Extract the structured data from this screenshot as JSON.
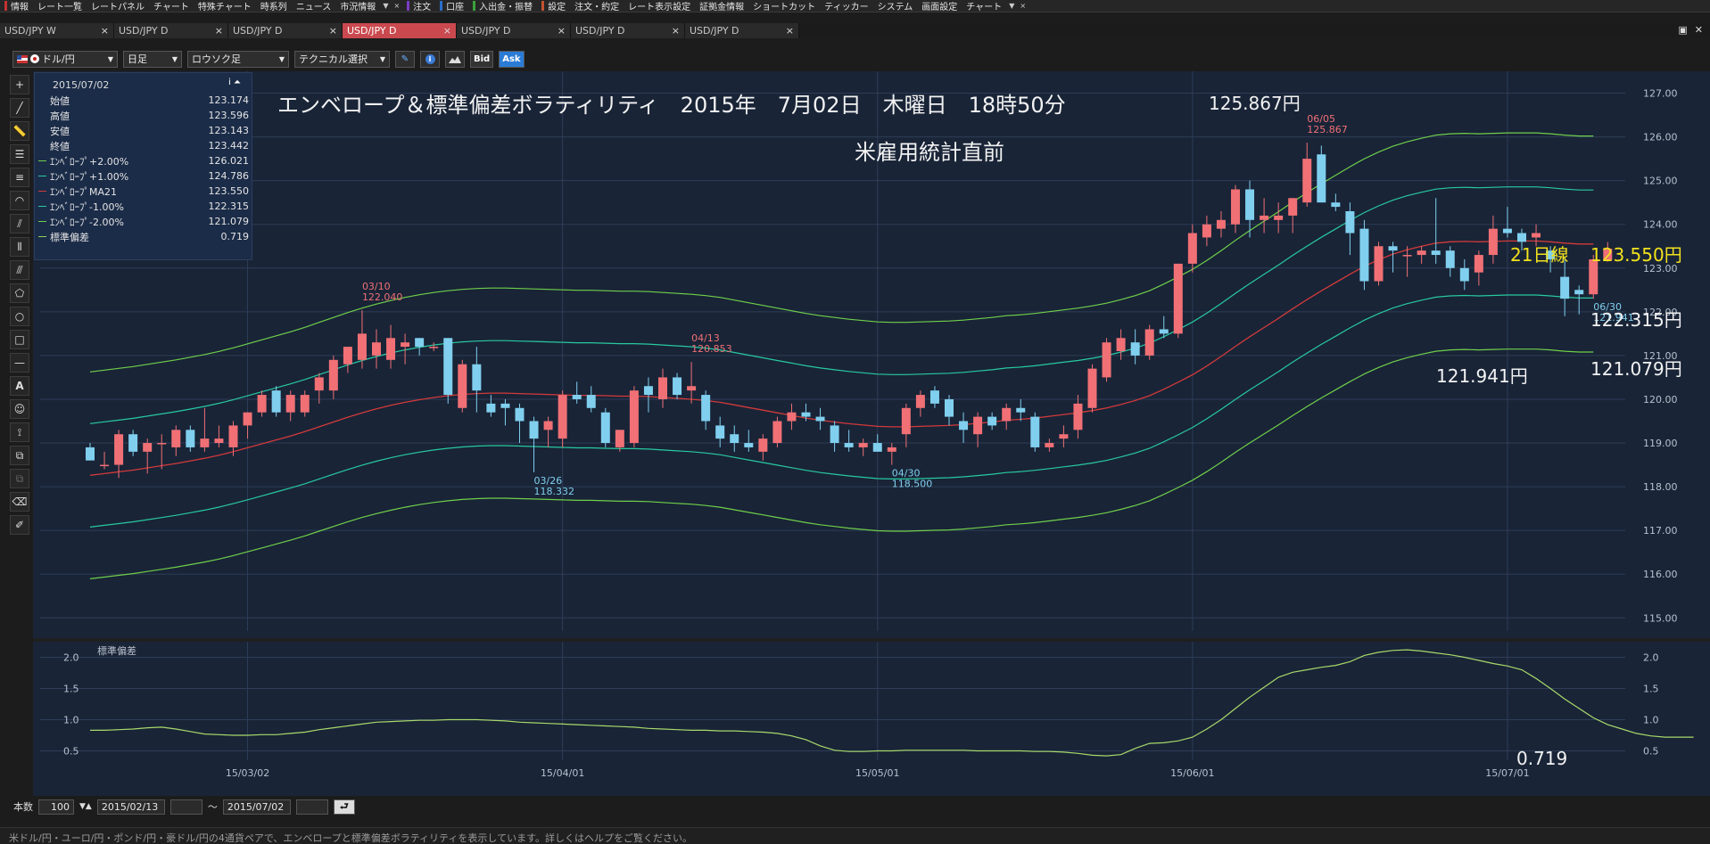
{
  "menubar": {
    "items": [
      {
        "label": "情報",
        "mark": "#c43232"
      },
      {
        "label": "レート一覧",
        "mark": ""
      },
      {
        "label": "レートパネル",
        "mark": ""
      },
      {
        "label": "チャート",
        "mark": ""
      },
      {
        "label": "特殊チャート",
        "mark": ""
      },
      {
        "label": "時系列",
        "mark": ""
      },
      {
        "label": "ニュース",
        "mark": ""
      },
      {
        "label": "市況情報",
        "mark": ""
      },
      {
        "label": "▼",
        "mark": "",
        "arrow": true
      },
      {
        "label": "×",
        "mark": "",
        "arrow": true
      },
      {
        "label": "注文",
        "mark": "#7b3cc4"
      },
      {
        "label": "口座",
        "mark": "#2a6ec9"
      },
      {
        "label": "入出金・振替",
        "mark": "#3aa13a"
      },
      {
        "label": "設定",
        "mark": "#c4522f"
      },
      {
        "label": "注文・約定",
        "mark": ""
      },
      {
        "label": "レート表示設定",
        "mark": ""
      },
      {
        "label": "証拠金情報",
        "mark": ""
      },
      {
        "label": "ショートカット",
        "mark": ""
      },
      {
        "label": "ティッカー",
        "mark": ""
      },
      {
        "label": "システム",
        "mark": ""
      },
      {
        "label": "画面設定",
        "mark": ""
      },
      {
        "label": "チャート",
        "mark": ""
      },
      {
        "label": "▼",
        "mark": "",
        "arrow": true
      },
      {
        "label": "×",
        "mark": "",
        "arrow": true
      }
    ]
  },
  "tabs": [
    {
      "label": "USD/JPY W",
      "close": "×",
      "active": false
    },
    {
      "label": "USD/JPY D",
      "close": "×",
      "active": false
    },
    {
      "label": "USD/JPY D",
      "close": "×",
      "active": false
    },
    {
      "label": "USD/JPY D",
      "close": "×",
      "active": true
    },
    {
      "label": "USD/JPY D",
      "close": "×",
      "active": false
    },
    {
      "label": "USD/JPY D",
      "close": "×",
      "active": false
    },
    {
      "label": "USD/JPY D",
      "close": "×",
      "active": false
    }
  ],
  "window_buttons": [
    "▣",
    "✕"
  ],
  "toolbar": {
    "pair": "ドル/円",
    "period": "日足",
    "chart_type": "ロウソク足",
    "technical": "テクニカル選択",
    "bid": "Bid",
    "ask": "Ask"
  },
  "infobox": {
    "date": "2015/07/02",
    "icons": "i ⏶",
    "rows": [
      {
        "label": "始値",
        "value": "123.174",
        "color": ""
      },
      {
        "label": "高値",
        "value": "123.596",
        "color": ""
      },
      {
        "label": "安値",
        "value": "123.143",
        "color": ""
      },
      {
        "label": "終値",
        "value": "123.442",
        "color": ""
      },
      {
        "label": "ｴﾝﾍﾞﾛｰﾌﾟ+2.00%",
        "value": "126.021",
        "color": "#6fcf4a"
      },
      {
        "label": "ｴﾝﾍﾞﾛｰﾌﾟ+1.00%",
        "value": "124.786",
        "color": "#28c9a0"
      },
      {
        "label": "ｴﾝﾍﾞﾛｰﾌﾟMA21",
        "value": "123.550",
        "color": "#d23a3a"
      },
      {
        "label": "ｴﾝﾍﾞﾛｰﾌﾟ-1.00%",
        "value": "122.315",
        "color": "#28c9a0"
      },
      {
        "label": "ｴﾝﾍﾞﾛｰﾌﾟ-2.00%",
        "value": "121.079",
        "color": "#6fcf4a"
      },
      {
        "label": "標準偏差",
        "value": "0.719",
        "color": "#8fcf5a"
      }
    ]
  },
  "annotations": {
    "title": "エンベロープ＆標準偏差ボラティリティ　2015年　7月02日　木曜日　18時50分",
    "high_price": "125.867円",
    "subtitle": "米雇用統計直前",
    "ma_label": "21日線",
    "ma_price": "123.550円",
    "env_minus1": "122.315円",
    "env_minus2": "121.079円",
    "low_price": "121.941円",
    "sd_value": "0.719"
  },
  "chart_data": {
    "type": "candlestick",
    "main_y_range": [
      114.7,
      127.5
    ],
    "y_ticks": [
      "127.00",
      "126.00",
      "125.00",
      "124.00",
      "123.00",
      "122.00",
      "121.00",
      "120.00",
      "119.00",
      "118.00",
      "117.00",
      "116.00",
      "115.00"
    ],
    "x_ticks": [
      "15/03/02",
      "15/04/01",
      "15/05/01",
      "15/06/01",
      "15/07/01"
    ],
    "colors": {
      "up": "#f07075",
      "down": "#80cfee",
      "ma": "#d23a3a",
      "env1": "#28c9a0",
      "env2": "#6fcf4a",
      "sd": "#a9d96a",
      "bg": "#192437",
      "grid": "#2e3d57"
    },
    "candles": [
      {
        "o": 118.9,
        "h": 119.0,
        "l": 118.6,
        "c": 118.6
      },
      {
        "o": 118.5,
        "h": 118.8,
        "l": 118.4,
        "c": 118.5
      },
      {
        "o": 118.5,
        "h": 119.3,
        "l": 118.2,
        "c": 119.2
      },
      {
        "o": 119.2,
        "h": 119.3,
        "l": 118.7,
        "c": 118.8
      },
      {
        "o": 118.8,
        "h": 119.1,
        "l": 118.3,
        "c": 119.0
      },
      {
        "o": 119.0,
        "h": 119.2,
        "l": 118.4,
        "c": 119.0
      },
      {
        "o": 118.9,
        "h": 119.4,
        "l": 118.7,
        "c": 119.3
      },
      {
        "o": 119.3,
        "h": 119.4,
        "l": 118.8,
        "c": 118.9
      },
      {
        "o": 118.9,
        "h": 119.8,
        "l": 118.8,
        "c": 119.1
      },
      {
        "o": 119.0,
        "h": 119.4,
        "l": 118.9,
        "c": 119.1
      },
      {
        "o": 118.9,
        "h": 119.5,
        "l": 118.7,
        "c": 119.4
      },
      {
        "o": 119.4,
        "h": 119.7,
        "l": 119.1,
        "c": 119.7
      },
      {
        "o": 119.7,
        "h": 120.2,
        "l": 119.6,
        "c": 120.1
      },
      {
        "o": 120.2,
        "h": 120.3,
        "l": 119.6,
        "c": 119.7
      },
      {
        "o": 119.7,
        "h": 120.2,
        "l": 119.5,
        "c": 120.1
      },
      {
        "o": 119.7,
        "h": 120.2,
        "l": 119.6,
        "c": 120.1
      },
      {
        "o": 120.2,
        "h": 120.6,
        "l": 119.9,
        "c": 120.5
      },
      {
        "o": 120.2,
        "h": 121.0,
        "l": 120.0,
        "c": 120.9
      },
      {
        "o": 120.8,
        "h": 121.2,
        "l": 120.6,
        "c": 121.2
      },
      {
        "o": 120.9,
        "h": 122.04,
        "l": 120.7,
        "c": 121.5
      },
      {
        "o": 121.0,
        "h": 121.6,
        "l": 120.7,
        "c": 121.3
      },
      {
        "o": 120.9,
        "h": 121.7,
        "l": 120.7,
        "c": 121.4
      },
      {
        "o": 121.2,
        "h": 121.5,
        "l": 120.8,
        "c": 121.3
      },
      {
        "o": 121.4,
        "h": 121.4,
        "l": 121.0,
        "c": 121.2
      },
      {
        "o": 121.2,
        "h": 121.3,
        "l": 121.1,
        "c": 121.2
      },
      {
        "o": 121.4,
        "h": 121.4,
        "l": 119.9,
        "c": 120.1
      },
      {
        "o": 119.8,
        "h": 120.9,
        "l": 119.7,
        "c": 120.8
      },
      {
        "o": 120.8,
        "h": 121.2,
        "l": 119.7,
        "c": 120.2
      },
      {
        "o": 119.9,
        "h": 120.1,
        "l": 119.6,
        "c": 119.7
      },
      {
        "o": 119.9,
        "h": 120.0,
        "l": 119.4,
        "c": 119.8
      },
      {
        "o": 119.8,
        "h": 119.9,
        "l": 119.0,
        "c": 119.5
      },
      {
        "o": 119.5,
        "h": 119.6,
        "l": 118.332,
        "c": 119.1
      },
      {
        "o": 119.3,
        "h": 119.6,
        "l": 118.9,
        "c": 119.5
      },
      {
        "o": 119.1,
        "h": 120.2,
        "l": 118.9,
        "c": 120.1
      },
      {
        "o": 120.1,
        "h": 120.4,
        "l": 119.9,
        "c": 120.0
      },
      {
        "o": 120.1,
        "h": 120.3,
        "l": 119.7,
        "c": 119.8
      },
      {
        "o": 119.7,
        "h": 119.8,
        "l": 118.9,
        "c": 119.0
      },
      {
        "o": 118.9,
        "h": 119.3,
        "l": 118.8,
        "c": 119.3
      },
      {
        "o": 119.0,
        "h": 120.3,
        "l": 118.9,
        "c": 120.2
      },
      {
        "o": 120.3,
        "h": 120.5,
        "l": 119.7,
        "c": 120.1
      },
      {
        "o": 120.0,
        "h": 120.7,
        "l": 119.8,
        "c": 120.5
      },
      {
        "o": 120.5,
        "h": 120.6,
        "l": 120.0,
        "c": 120.1
      },
      {
        "o": 120.2,
        "h": 120.853,
        "l": 119.9,
        "c": 120.3
      },
      {
        "o": 120.1,
        "h": 120.2,
        "l": 119.3,
        "c": 119.5
      },
      {
        "o": 119.4,
        "h": 119.6,
        "l": 118.9,
        "c": 119.1
      },
      {
        "o": 119.2,
        "h": 119.4,
        "l": 118.8,
        "c": 119.0
      },
      {
        "o": 119.0,
        "h": 119.3,
        "l": 118.8,
        "c": 118.9
      },
      {
        "o": 118.8,
        "h": 119.2,
        "l": 118.6,
        "c": 119.1
      },
      {
        "o": 119.0,
        "h": 119.6,
        "l": 118.9,
        "c": 119.5
      },
      {
        "o": 119.5,
        "h": 119.9,
        "l": 119.3,
        "c": 119.7
      },
      {
        "o": 119.7,
        "h": 119.9,
        "l": 119.5,
        "c": 119.6
      },
      {
        "o": 119.6,
        "h": 119.8,
        "l": 119.3,
        "c": 119.5
      },
      {
        "o": 119.4,
        "h": 119.5,
        "l": 118.8,
        "c": 119.0
      },
      {
        "o": 119.0,
        "h": 119.3,
        "l": 118.8,
        "c": 118.9
      },
      {
        "o": 118.9,
        "h": 119.1,
        "l": 118.7,
        "c": 119.0
      },
      {
        "o": 119.0,
        "h": 119.2,
        "l": 118.8,
        "c": 118.8
      },
      {
        "o": 118.8,
        "h": 119.0,
        "l": 118.5,
        "c": 118.9
      },
      {
        "o": 119.2,
        "h": 119.9,
        "l": 118.9,
        "c": 119.8
      },
      {
        "o": 119.8,
        "h": 120.2,
        "l": 119.6,
        "c": 120.1
      },
      {
        "o": 120.2,
        "h": 120.3,
        "l": 119.8,
        "c": 119.9
      },
      {
        "o": 120.0,
        "h": 120.1,
        "l": 119.4,
        "c": 119.6
      },
      {
        "o": 119.5,
        "h": 119.7,
        "l": 119.0,
        "c": 119.3
      },
      {
        "o": 119.2,
        "h": 119.7,
        "l": 118.9,
        "c": 119.6
      },
      {
        "o": 119.6,
        "h": 119.7,
        "l": 119.3,
        "c": 119.4
      },
      {
        "o": 119.5,
        "h": 119.9,
        "l": 119.3,
        "c": 119.8
      },
      {
        "o": 119.8,
        "h": 120.0,
        "l": 119.5,
        "c": 119.7
      },
      {
        "o": 119.6,
        "h": 119.7,
        "l": 118.8,
        "c": 118.9
      },
      {
        "o": 118.9,
        "h": 119.1,
        "l": 118.8,
        "c": 119.0
      },
      {
        "o": 119.1,
        "h": 119.4,
        "l": 118.9,
        "c": 119.2
      },
      {
        "o": 119.3,
        "h": 120.1,
        "l": 119.1,
        "c": 119.9
      },
      {
        "o": 119.8,
        "h": 120.8,
        "l": 119.7,
        "c": 120.7
      },
      {
        "o": 120.5,
        "h": 121.4,
        "l": 120.4,
        "c": 121.3
      },
      {
        "o": 121.1,
        "h": 121.6,
        "l": 120.9,
        "c": 121.4
      },
      {
        "o": 121.3,
        "h": 121.6,
        "l": 120.8,
        "c": 121.0
      },
      {
        "o": 121.0,
        "h": 121.7,
        "l": 120.9,
        "c": 121.6
      },
      {
        "o": 121.6,
        "h": 121.9,
        "l": 121.4,
        "c": 121.5
      },
      {
        "o": 121.5,
        "h": 123.1,
        "l": 121.4,
        "c": 123.1
      },
      {
        "o": 123.1,
        "h": 124.0,
        "l": 122.9,
        "c": 123.8
      },
      {
        "o": 123.7,
        "h": 124.2,
        "l": 123.5,
        "c": 124.0
      },
      {
        "o": 123.9,
        "h": 124.3,
        "l": 123.7,
        "c": 124.1
      },
      {
        "o": 124.0,
        "h": 124.9,
        "l": 123.8,
        "c": 124.8
      },
      {
        "o": 124.8,
        "h": 125.0,
        "l": 123.7,
        "c": 124.1
      },
      {
        "o": 124.1,
        "h": 124.6,
        "l": 123.8,
        "c": 124.2
      },
      {
        "o": 124.1,
        "h": 124.5,
        "l": 123.8,
        "c": 124.2
      },
      {
        "o": 124.2,
        "h": 124.6,
        "l": 123.8,
        "c": 124.6
      },
      {
        "o": 124.5,
        "h": 125.867,
        "l": 124.4,
        "c": 125.5
      },
      {
        "o": 125.6,
        "h": 125.8,
        "l": 124.5,
        "c": 124.5
      },
      {
        "o": 124.5,
        "h": 124.7,
        "l": 124.3,
        "c": 124.4
      },
      {
        "o": 124.3,
        "h": 124.5,
        "l": 123.3,
        "c": 123.8
      },
      {
        "o": 123.9,
        "h": 124.1,
        "l": 122.5,
        "c": 122.7
      },
      {
        "o": 122.7,
        "h": 123.6,
        "l": 122.6,
        "c": 123.5
      },
      {
        "o": 123.5,
        "h": 123.6,
        "l": 122.9,
        "c": 123.4
      },
      {
        "o": 123.3,
        "h": 123.5,
        "l": 122.8,
        "c": 123.3
      },
      {
        "o": 123.3,
        "h": 123.5,
        "l": 123.1,
        "c": 123.4
      },
      {
        "o": 123.4,
        "h": 124.6,
        "l": 123.1,
        "c": 123.3
      },
      {
        "o": 123.4,
        "h": 123.5,
        "l": 122.8,
        "c": 123.0
      },
      {
        "o": 123.0,
        "h": 123.2,
        "l": 122.5,
        "c": 122.7
      },
      {
        "o": 122.9,
        "h": 123.4,
        "l": 122.6,
        "c": 123.3
      },
      {
        "o": 123.3,
        "h": 124.2,
        "l": 123.1,
        "c": 123.9
      },
      {
        "o": 123.9,
        "h": 124.4,
        "l": 123.7,
        "c": 123.8
      },
      {
        "o": 123.8,
        "h": 123.9,
        "l": 123.4,
        "c": 123.6
      },
      {
        "o": 123.7,
        "h": 124.0,
        "l": 123.5,
        "c": 123.8
      },
      {
        "o": 123.4,
        "h": 123.5,
        "l": 122.9,
        "c": 123.2
      },
      {
        "o": 122.8,
        "h": 123.2,
        "l": 121.9,
        "c": 122.3
      },
      {
        "o": 122.5,
        "h": 122.6,
        "l": 121.941,
        "c": 122.4
      },
      {
        "o": 122.4,
        "h": 123.3,
        "l": 122.3,
        "c": 123.2
      },
      {
        "o": 123.174,
        "h": 123.596,
        "l": 123.143,
        "c": 123.442
      }
    ],
    "ma21": [
      118.26,
      118.3,
      118.34,
      118.38,
      118.43,
      118.48,
      118.53,
      118.59,
      118.65,
      118.72,
      118.8,
      118.89,
      118.98,
      119.07,
      119.16,
      119.26,
      119.37,
      119.48,
      119.59,
      119.69,
      119.78,
      119.86,
      119.93,
      119.99,
      120.04,
      120.08,
      120.11,
      120.13,
      120.14,
      120.14,
      120.13,
      120.12,
      120.11,
      120.1,
      120.09,
      120.09,
      120.08,
      120.07,
      120.07,
      120.06,
      120.04,
      120.02,
      120.0,
      119.97,
      119.93,
      119.87,
      119.81,
      119.75,
      119.69,
      119.63,
      119.57,
      119.52,
      119.48,
      119.44,
      119.41,
      119.38,
      119.37,
      119.37,
      119.38,
      119.39,
      119.4,
      119.42,
      119.45,
      119.48,
      119.52,
      119.54,
      119.57,
      119.61,
      119.65,
      119.69,
      119.74,
      119.8,
      119.88,
      119.97,
      120.08,
      120.23,
      120.39,
      120.56,
      120.76,
      120.98,
      121.21,
      121.43,
      121.64,
      121.85,
      122.07,
      122.28,
      122.48,
      122.67,
      122.86,
      123.04,
      123.19,
      123.32,
      123.42,
      123.5,
      123.57,
      123.6,
      123.61,
      123.6,
      123.61,
      123.62,
      123.62,
      123.62,
      123.6,
      123.57,
      123.55,
      123.55
    ],
    "sd": [
      0.83,
      0.83,
      0.84,
      0.85,
      0.87,
      0.88,
      0.85,
      0.81,
      0.77,
      0.76,
      0.75,
      0.75,
      0.76,
      0.76,
      0.78,
      0.8,
      0.84,
      0.87,
      0.9,
      0.93,
      0.96,
      0.97,
      0.98,
      0.99,
      0.99,
      1.0,
      1.0,
      1.0,
      0.99,
      0.98,
      0.96,
      0.95,
      0.94,
      0.93,
      0.92,
      0.91,
      0.9,
      0.89,
      0.88,
      0.86,
      0.85,
      0.84,
      0.83,
      0.83,
      0.82,
      0.82,
      0.81,
      0.8,
      0.78,
      0.74,
      0.68,
      0.58,
      0.51,
      0.49,
      0.49,
      0.5,
      0.5,
      0.51,
      0.51,
      0.51,
      0.51,
      0.51,
      0.5,
      0.5,
      0.5,
      0.5,
      0.49,
      0.49,
      0.48,
      0.46,
      0.43,
      0.42,
      0.44,
      0.54,
      0.62,
      0.63,
      0.66,
      0.72,
      0.85,
      1.0,
      1.18,
      1.36,
      1.52,
      1.68,
      1.76,
      1.8,
      1.84,
      1.87,
      1.93,
      2.03,
      2.08,
      2.11,
      2.12,
      2.1,
      2.07,
      2.04,
      2.0,
      1.95,
      1.9,
      1.86,
      1.8,
      1.66,
      1.5,
      1.33,
      1.18,
      1.03,
      0.92,
      0.85,
      0.78,
      0.74,
      0.72,
      0.72,
      0.72
    ],
    "sd_ticks": [
      "2.0",
      "1.5",
      "1.0",
      "0.5"
    ],
    "sd_label": "標準偏差",
    "sd_y_range": [
      0.35,
      2.25
    ],
    "labels": [
      {
        "i": 19,
        "kind": "high",
        "date": "03/10",
        "price": "122.040"
      },
      {
        "i": 31,
        "kind": "low",
        "date": "03/26",
        "price": "118.332"
      },
      {
        "i": 42,
        "kind": "high",
        "date": "04/13",
        "price": "120.853"
      },
      {
        "i": 56,
        "kind": "low",
        "date": "04/30",
        "price": "118.500"
      },
      {
        "i": 85,
        "kind": "high",
        "date": "06/05",
        "price": "125.867"
      },
      {
        "i": 105,
        "kind": "low",
        "date": "06/30",
        "price": "121.941"
      }
    ]
  },
  "bottombar": {
    "count_label": "本数",
    "count_value": "100",
    "spin": "▼▲",
    "from_date": "2015/02/13",
    "tilde": "〜",
    "to_date": "2015/07/02",
    "go_icon": "⮐"
  },
  "statusbar": {
    "text": "米ドル/円・ユーロ/円・ポンド/円・豪ドル/円の4通貨ペアで、エンベロープと標準偏差ボラティリティを表示しています。詳しくはヘルプをご覧ください。"
  }
}
